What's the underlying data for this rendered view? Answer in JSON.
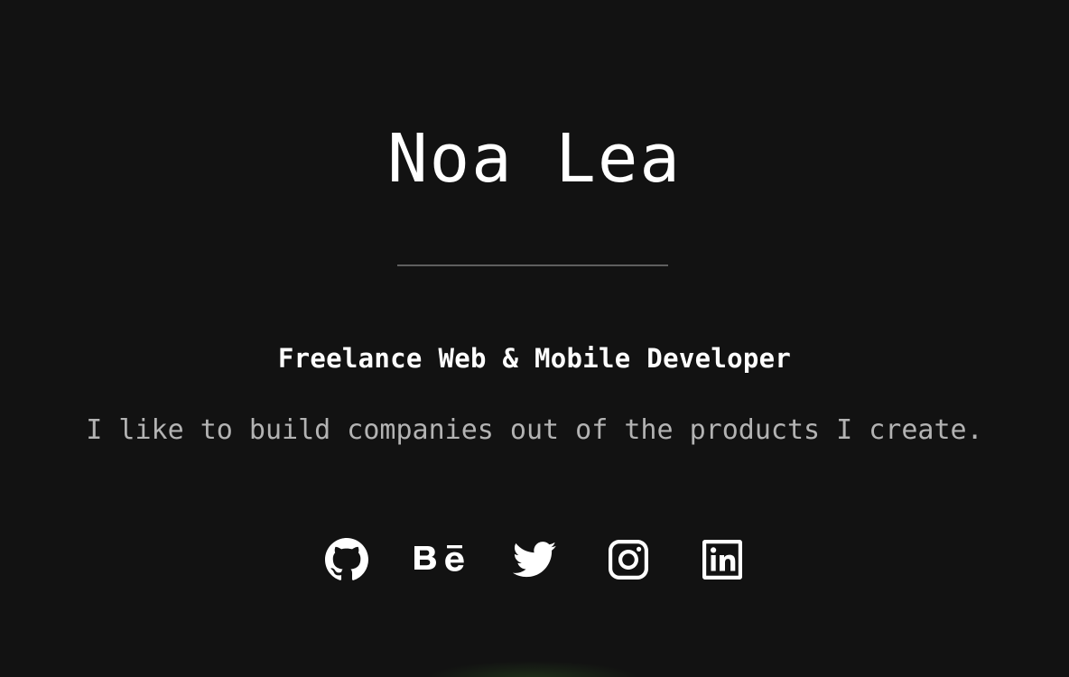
{
  "profile": {
    "name": "Noa Lea",
    "headline": "Freelance Web & Mobile Developer",
    "tagline": "I like to build companies out of the products I create."
  },
  "social_links": [
    {
      "name": "GitHub",
      "icon": "github-icon"
    },
    {
      "name": "Behance",
      "icon": "behance-icon"
    },
    {
      "name": "Twitter",
      "icon": "twitter-icon"
    },
    {
      "name": "Instagram",
      "icon": "instagram-icon"
    },
    {
      "name": "LinkedIn",
      "icon": "linkedin-icon"
    }
  ],
  "colors": {
    "background": "#121212",
    "text": "#ffffff",
    "muted_text": "#b3b3b3",
    "divider": "#5f5f5f"
  }
}
